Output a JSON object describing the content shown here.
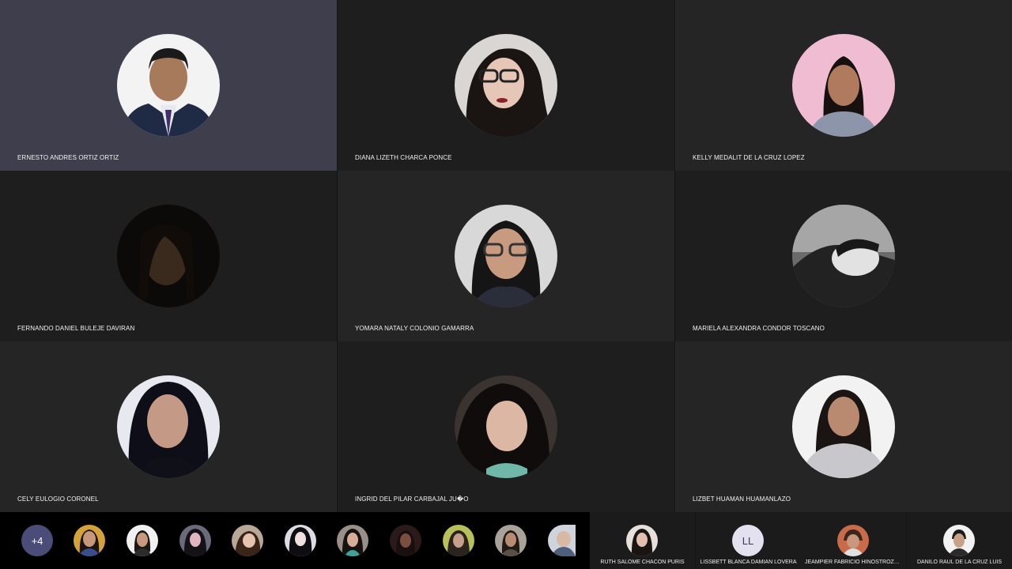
{
  "colors": {
    "active_tile": "#3f3e4c",
    "tile_a": "#1e1e1e",
    "tile_b": "#252525",
    "strip": "#000000",
    "badge": "#4b4d78"
  },
  "participants": [
    {
      "name": "ERNESTO ANDRES ORTIZ ORTIZ"
    },
    {
      "name": "DIANA LIZETH CHARCA PONCE"
    },
    {
      "name": "KELLY MEDALIT DE LA CRUZ LOPEZ"
    },
    {
      "name": "FERNANDO DANIEL BULEJE DAVIRAN"
    },
    {
      "name": "YOMARA NATALY COLONIO GAMARRA"
    },
    {
      "name": "MARIELA ALEXANDRA CONDOR TOSCANO"
    },
    {
      "name": "CELY EULOGIO CORONEL"
    },
    {
      "name": "INGRID DEL PILAR CARBAJAL JU�O"
    },
    {
      "name": "LIZBET HUAMAN HUAMANLAZO"
    }
  ],
  "strip": {
    "more_count": "+4",
    "thumbnails": 10
  },
  "side_participants": [
    {
      "name": "RUTH SALOME CHACON PURIS"
    },
    {
      "name": "LISSBETT BLANCA DAMIAN LOVERA",
      "initials": "LL"
    },
    {
      "name": "JEAMPIER FABRICIO HINOSTROZA..."
    },
    {
      "name": "DANILO RAUL DE LA CRUZ LUIS"
    }
  ]
}
